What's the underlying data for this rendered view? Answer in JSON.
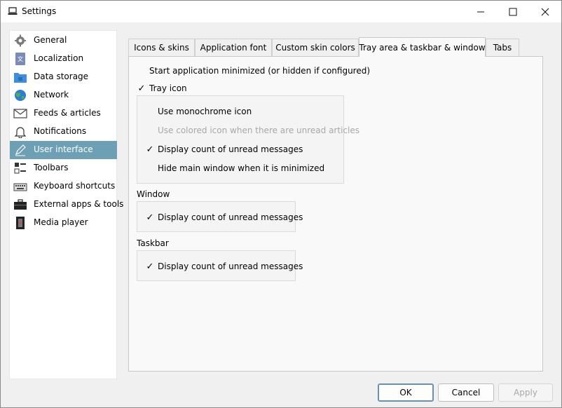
{
  "window": {
    "title": "Settings"
  },
  "sidebar": {
    "items": [
      {
        "label": "General",
        "icon": "gear-icon"
      },
      {
        "label": "Localization",
        "icon": "translate-icon"
      },
      {
        "label": "Data storage",
        "icon": "folder-lock-icon"
      },
      {
        "label": "Network",
        "icon": "globe-icon"
      },
      {
        "label": "Feeds & articles",
        "icon": "envelope-icon"
      },
      {
        "label": "Notifications",
        "icon": "bell-icon"
      },
      {
        "label": "User interface",
        "icon": "pen-icon",
        "selected": true
      },
      {
        "label": "Toolbars",
        "icon": "toolbar-icon"
      },
      {
        "label": "Keyboard shortcuts",
        "icon": "keyboard-icon"
      },
      {
        "label": "External apps & tools",
        "icon": "toolbox-icon"
      },
      {
        "label": "Media player",
        "icon": "film-icon"
      }
    ]
  },
  "tabs": [
    {
      "label": "Icons & skins"
    },
    {
      "label": "Application font"
    },
    {
      "label": "Custom skin colors"
    },
    {
      "label": "Tray area & taskbar & window",
      "active": true
    },
    {
      "label": "Tabs"
    }
  ],
  "tray_tab": {
    "start_minimized": {
      "label": "Start application minimized (or hidden if configured)",
      "checked": false
    },
    "tray_icon": {
      "label": "Tray icon",
      "checked": true
    },
    "tray_group": {
      "monochrome": {
        "label": "Use monochrome icon",
        "checked": false
      },
      "colored": {
        "label": "Use colored icon when there are unread articles",
        "checked": false,
        "disabled": true
      },
      "display_count": {
        "label": "Display count of unread messages",
        "checked": true
      },
      "hide_main": {
        "label": "Hide main window when it is minimized",
        "checked": false
      }
    },
    "window_section": {
      "title": "Window",
      "display_count": {
        "label": "Display count of unread messages",
        "checked": true
      }
    },
    "taskbar_section": {
      "title": "Taskbar",
      "display_count": {
        "label": "Display count of unread messages",
        "checked": true
      }
    }
  },
  "buttons": {
    "ok": "OK",
    "cancel": "Cancel",
    "apply": "Apply"
  },
  "checkmark_glyph": "✓",
  "colors": {
    "selection": "#6ea0b5",
    "disabled_text": "#a8a8a8"
  }
}
